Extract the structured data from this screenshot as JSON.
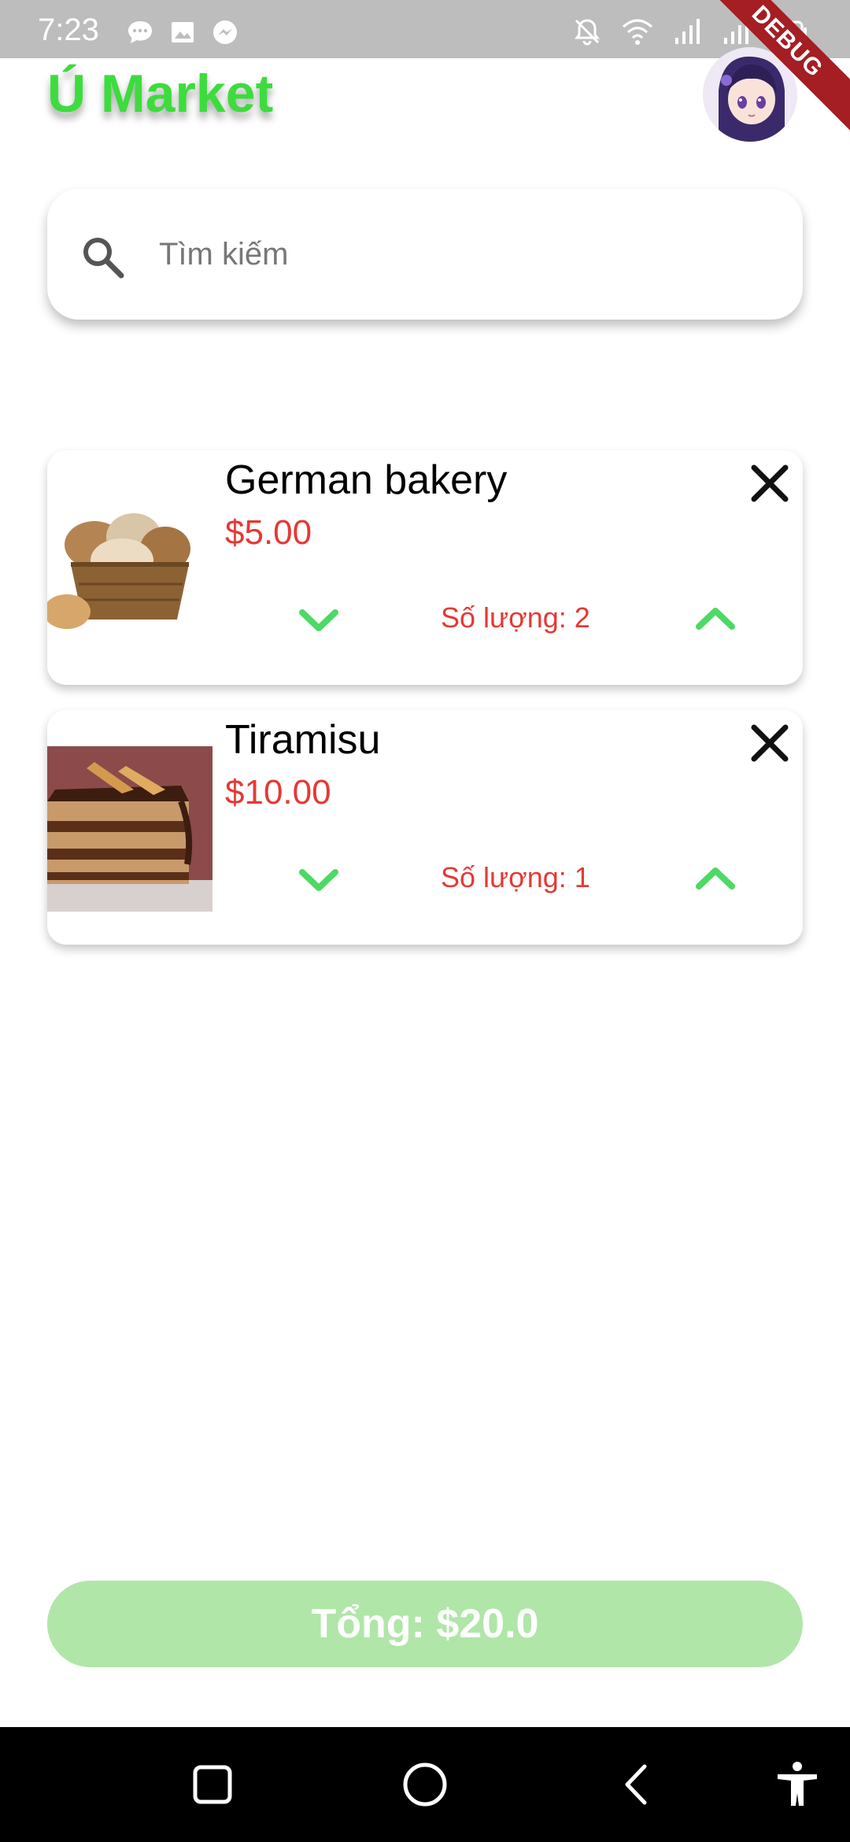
{
  "status_bar": {
    "time": "7:23",
    "left_icons": [
      "message-icon",
      "image-icon",
      "messenger-icon"
    ],
    "right_icons": [
      "bell-off-icon",
      "wifi-icon",
      "signal-icon",
      "signal-volte-icon",
      "battery-icon"
    ]
  },
  "debug_banner": "DEBUG",
  "header": {
    "title": "Ú Market",
    "title_color": "#3ddc3d",
    "avatar": "anime-avatar"
  },
  "search": {
    "placeholder": "Tìm kiếm",
    "value": ""
  },
  "cart": {
    "items": [
      {
        "name": "German bakery",
        "price": "$5.00",
        "quantity_label": "Số lượng: 2",
        "image": "bread-basket-image"
      },
      {
        "name": "Tiramisu",
        "price": "$10.00",
        "quantity_label": "Số lượng: 1",
        "image": "tiramisu-cake-image"
      }
    ]
  },
  "total": {
    "label": "Tổng: $20.0"
  },
  "colors": {
    "accent_green": "#3ddc3d",
    "chevron_green": "#4cd964",
    "price_red": "#e53935",
    "total_button": "#b0e6a8"
  },
  "nav": [
    "recent-apps-icon",
    "home-icon",
    "back-icon",
    "accessibility-icon"
  ]
}
